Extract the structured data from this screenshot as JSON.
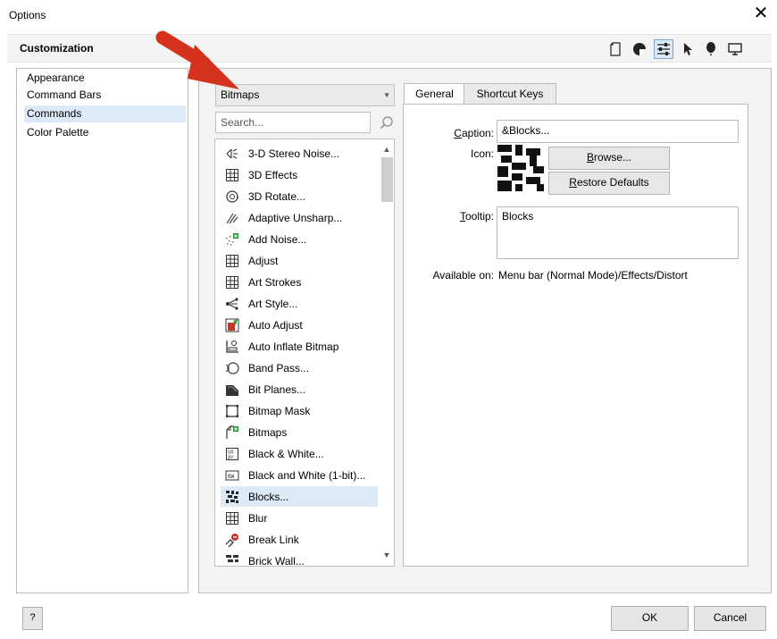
{
  "window": {
    "title": "Options",
    "close_glyph": "✕"
  },
  "header": {
    "title": "Customization",
    "toolbar": [
      {
        "icon": "page-icon"
      },
      {
        "icon": "palette-icon"
      },
      {
        "icon": "sliders-icon",
        "active": true
      },
      {
        "icon": "pointer-icon"
      },
      {
        "icon": "balloon-icon"
      },
      {
        "icon": "monitor-icon"
      }
    ]
  },
  "sidebar": {
    "items": [
      {
        "label": "Appearance"
      },
      {
        "label": "Command Bars"
      },
      {
        "label": "Commands",
        "selected": true
      },
      {
        "label": "Color Palette"
      }
    ]
  },
  "commands": {
    "category": "Bitmaps",
    "search_placeholder": "Search...",
    "items": [
      {
        "label": "3-D Stereo Noise...",
        "icon": "stereo-noise-icon"
      },
      {
        "label": "3D Effects",
        "icon": "grid-icon"
      },
      {
        "label": "3D Rotate...",
        "icon": "rotate-3d-icon"
      },
      {
        "label": "Adaptive Unsharp...",
        "icon": "unsharp-icon"
      },
      {
        "label": "Add Noise...",
        "icon": "noise-icon"
      },
      {
        "label": "Adjust",
        "icon": "grid-icon"
      },
      {
        "label": "Art Strokes",
        "icon": "grid-icon"
      },
      {
        "label": "Art Style...",
        "icon": "art-style-icon"
      },
      {
        "label": "Auto Adjust",
        "icon": "auto-adjust-icon"
      },
      {
        "label": "Auto Inflate Bitmap",
        "icon": "inflate-icon"
      },
      {
        "label": "Band Pass...",
        "icon": "band-pass-icon"
      },
      {
        "label": "Bit Planes...",
        "icon": "bit-planes-icon"
      },
      {
        "label": "Bitmap Mask",
        "icon": "mask-icon"
      },
      {
        "label": "Bitmaps",
        "icon": "bitmaps-icon"
      },
      {
        "label": "Black & White...",
        "icon": "bw-icon"
      },
      {
        "label": "Black and White (1-bit)...",
        "icon": "bw-1bit-icon"
      },
      {
        "label": "Blocks...",
        "icon": "blocks-icon",
        "selected": true
      },
      {
        "label": "Blur",
        "icon": "grid-icon"
      },
      {
        "label": "Break Link",
        "icon": "break-link-icon"
      },
      {
        "label": "Brick Wall...",
        "icon": "brick-icon"
      }
    ]
  },
  "tabs": [
    {
      "label": "General",
      "active": true
    },
    {
      "label": "Shortcut Keys",
      "active": false
    }
  ],
  "general": {
    "caption_label_u": "C",
    "caption_label_rest": "aption:",
    "caption_value": "&Blocks...",
    "icon_label": "Icon:",
    "browse_u": "B",
    "browse_rest": "rowse...",
    "restore_u": "R",
    "restore_rest": "estore Defaults",
    "tooltip_label_u": "T",
    "tooltip_label_rest": "ooltip:",
    "tooltip_value": "Blocks",
    "available_label": "Available on:",
    "available_value": "Menu bar (Normal Mode)/Effects/Distort"
  },
  "footer": {
    "help": "?",
    "ok": "OK",
    "cancel": "Cancel"
  },
  "colors": {
    "accent_red": "#d4321c",
    "selection": "#dce9f7"
  }
}
